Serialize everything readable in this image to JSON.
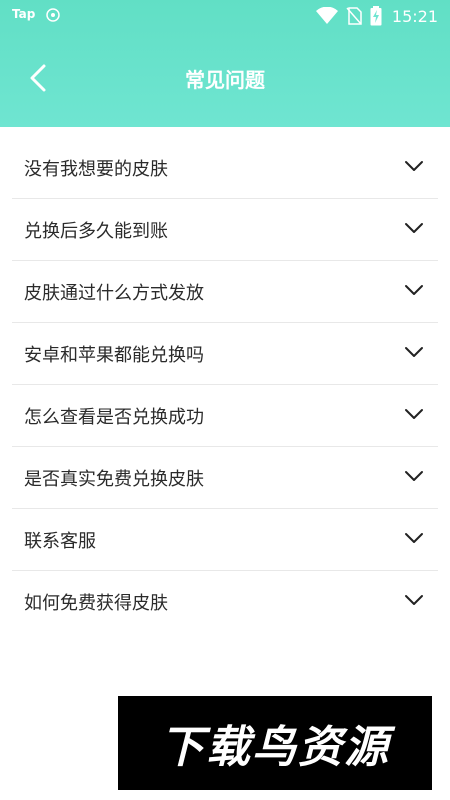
{
  "status_bar": {
    "carrier_label": "Tap",
    "time": "15:21"
  },
  "header": {
    "title": "常见问题"
  },
  "faq": {
    "items": [
      {
        "question": "没有我想要的皮肤"
      },
      {
        "question": "兑换后多久能到账"
      },
      {
        "question": "皮肤通过什么方式发放"
      },
      {
        "question": "安卓和苹果都能兑换吗"
      },
      {
        "question": "怎么查看是否兑换成功"
      },
      {
        "question": "是否真实免费兑换皮肤"
      },
      {
        "question": "联系客服"
      },
      {
        "question": "如何免费获得皮肤"
      }
    ]
  },
  "watermark": {
    "text": "下载鸟资源"
  },
  "colors": {
    "header_accent": "#61dfc5",
    "text_primary": "#2b2b2b",
    "divider": "#e8e8e8"
  },
  "icons": {
    "back": "chevron-left-icon",
    "expand": "chevron-down-icon",
    "wifi": "wifi-icon",
    "no_sim": "no-sim-icon",
    "battery": "battery-charging-icon"
  }
}
